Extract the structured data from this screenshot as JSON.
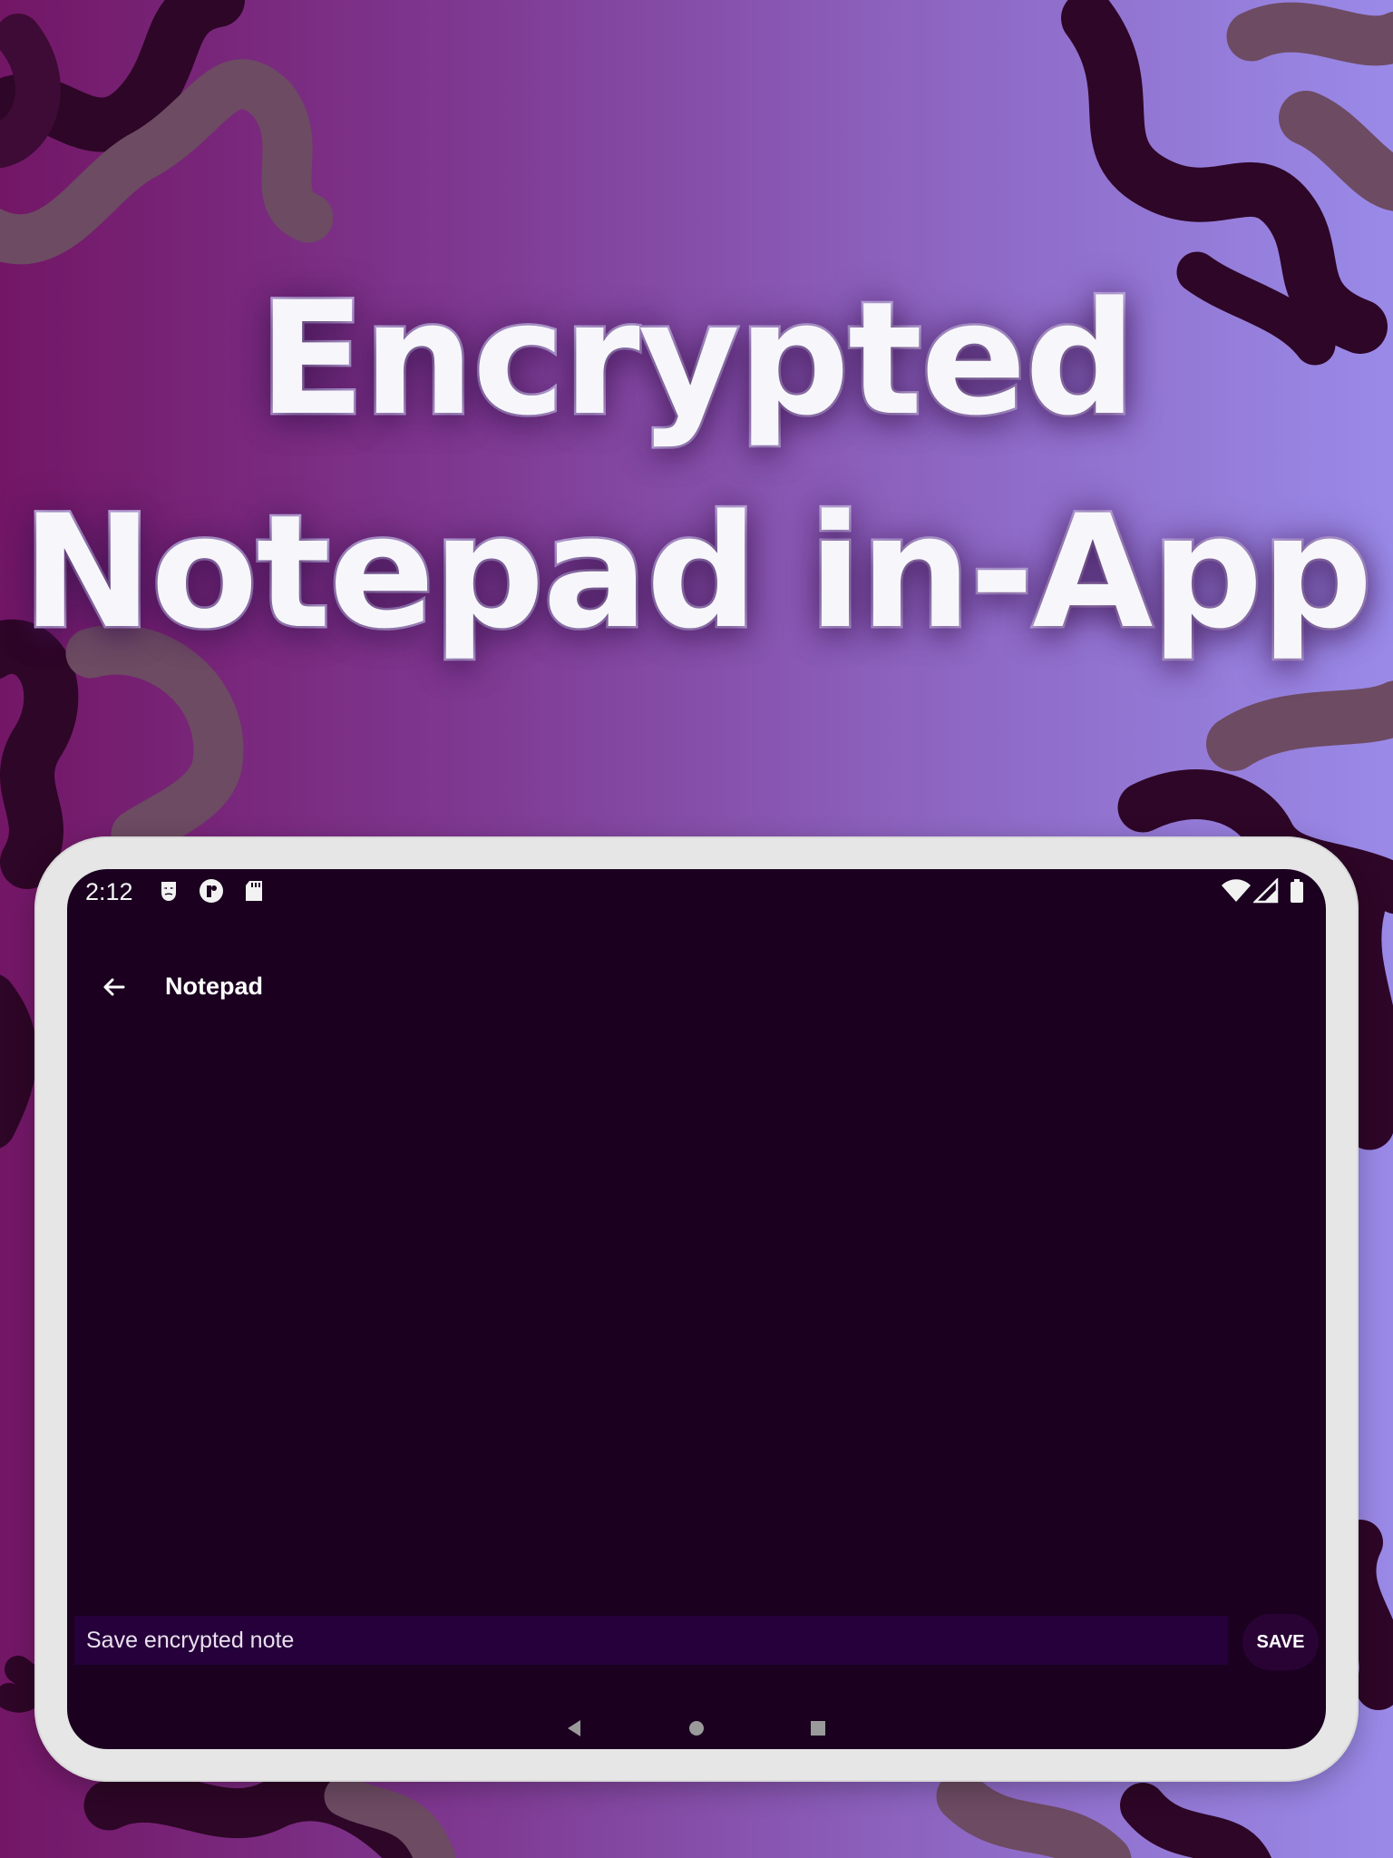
{
  "headline": {
    "line1": "Encrypted",
    "line2": "Notepad in-App"
  },
  "colors": {
    "background_left": "#731666",
    "background_right": "#9a8ae8",
    "blob_dark": "#2e0627",
    "blob_muted": "#6d4b63",
    "screen": "#1b0020",
    "input_bg": "#26003a"
  },
  "status_bar": {
    "time": "2:12",
    "left_icons": [
      "mask-icon",
      "circle-app-icon",
      "sd-card-icon"
    ],
    "right_icons": [
      "wifi-icon",
      "signal-icon",
      "battery-icon"
    ]
  },
  "app_bar": {
    "title": "Notepad",
    "back_icon": "arrow-left-icon"
  },
  "note": {
    "placeholder": "Save encrypted note",
    "save_label": "SAVE"
  },
  "nav_bar": {
    "icons": [
      "back-triangle-icon",
      "home-circle-icon",
      "recents-square-icon"
    ]
  }
}
